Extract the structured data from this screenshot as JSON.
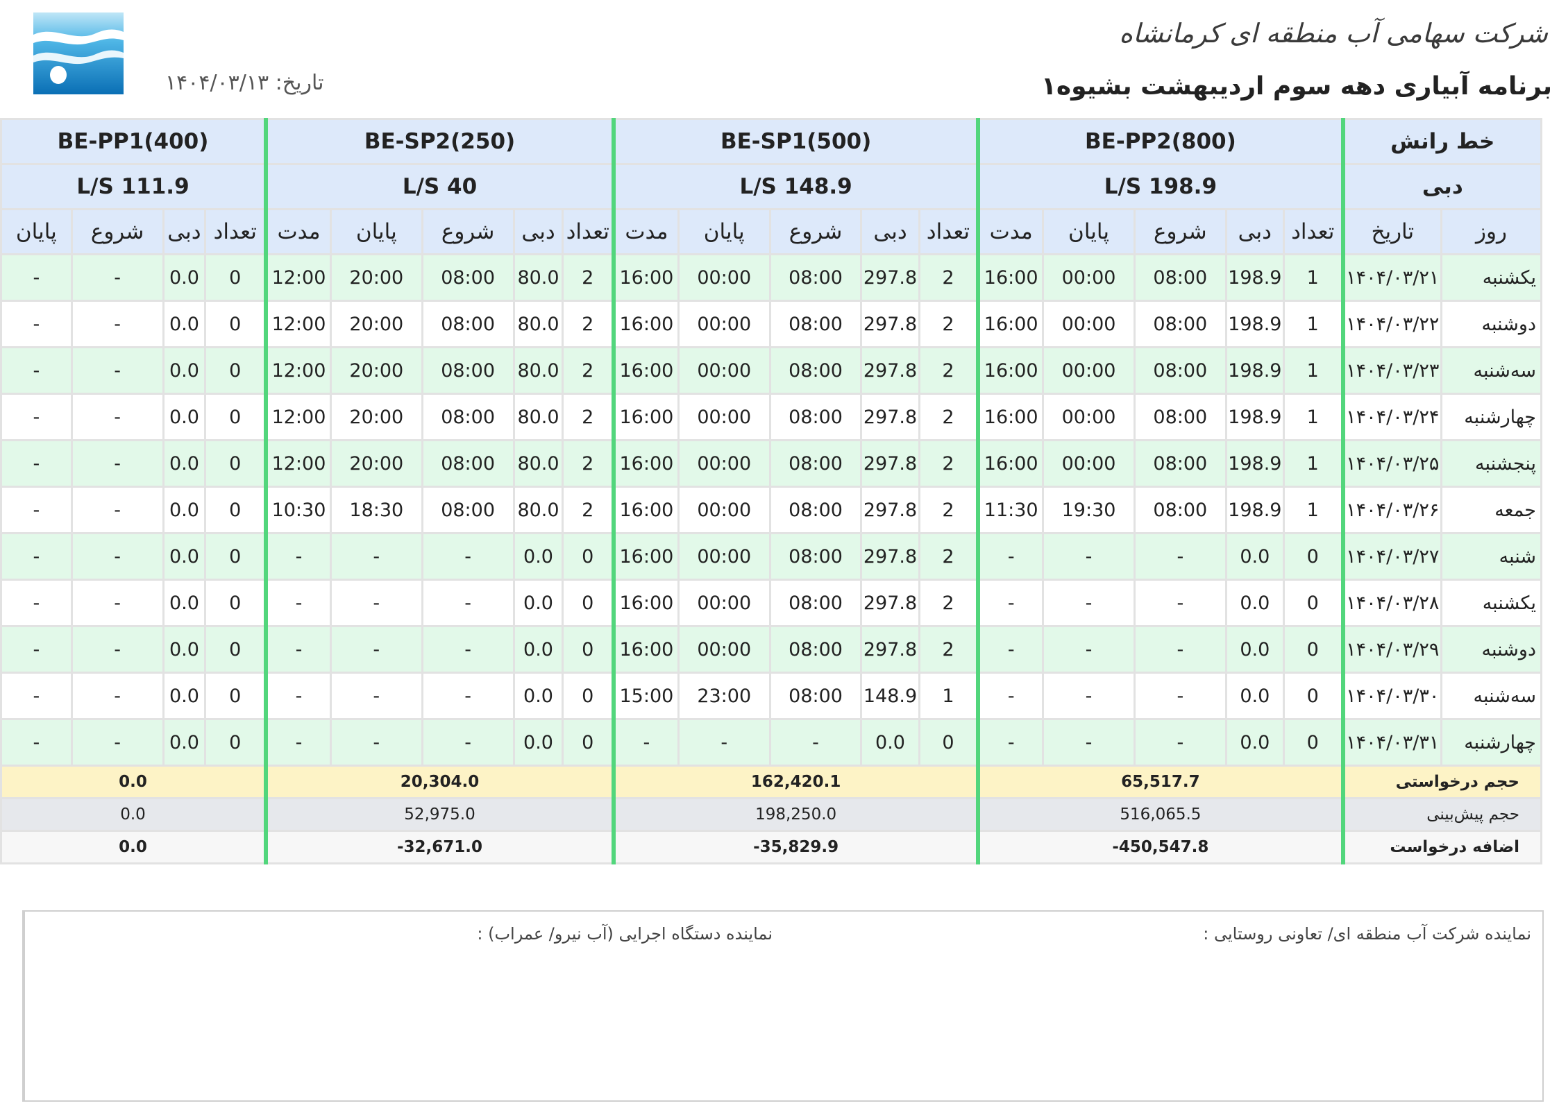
{
  "header": {
    "company": "شرکت سهامی آب منطقه ای کرمانشاه",
    "title": "برنامه آبیاری دهه سوم اردیبهشت بشیوه۱",
    "date_label": "تاریخ:",
    "date_value": "۱۴۰۴/۰۳/۱۳"
  },
  "columns": {
    "line_label": "خط رانش",
    "flow_label": "دبی",
    "day": "روز",
    "date": "تاریخ",
    "count": "تعداد",
    "flow": "دبی",
    "start": "شروع",
    "end": "پایان",
    "duration": "مدت"
  },
  "lines": [
    {
      "name": "BE-PP2(800)",
      "flow": "198.9 L/S"
    },
    {
      "name": "BE-SP1(500)",
      "flow": "148.9 L/S"
    },
    {
      "name": "BE-SP2(250)",
      "flow": "40 L/S"
    },
    {
      "name": "BE-PP1(400)",
      "flow": "111.9 L/S"
    }
  ],
  "rows": [
    {
      "day": "یکشنبه",
      "date": "۱۴۰۴/۰۳/۲۱",
      "l": [
        [
          "1",
          "198.9",
          "08:00",
          "00:00",
          "16:00"
        ],
        [
          "2",
          "297.8",
          "08:00",
          "00:00",
          "16:00"
        ],
        [
          "2",
          "80.0",
          "08:00",
          "20:00",
          "12:00"
        ],
        [
          "0",
          "0.0",
          "-",
          "-"
        ]
      ]
    },
    {
      "day": "دوشنبه",
      "date": "۱۴۰۴/۰۳/۲۲",
      "l": [
        [
          "1",
          "198.9",
          "08:00",
          "00:00",
          "16:00"
        ],
        [
          "2",
          "297.8",
          "08:00",
          "00:00",
          "16:00"
        ],
        [
          "2",
          "80.0",
          "08:00",
          "20:00",
          "12:00"
        ],
        [
          "0",
          "0.0",
          "-",
          "-"
        ]
      ]
    },
    {
      "day": "سه‌شنبه",
      "date": "۱۴۰۴/۰۳/۲۳",
      "l": [
        [
          "1",
          "198.9",
          "08:00",
          "00:00",
          "16:00"
        ],
        [
          "2",
          "297.8",
          "08:00",
          "00:00",
          "16:00"
        ],
        [
          "2",
          "80.0",
          "08:00",
          "20:00",
          "12:00"
        ],
        [
          "0",
          "0.0",
          "-",
          "-"
        ]
      ]
    },
    {
      "day": "چهارشنبه",
      "date": "۱۴۰۴/۰۳/۲۴",
      "l": [
        [
          "1",
          "198.9",
          "08:00",
          "00:00",
          "16:00"
        ],
        [
          "2",
          "297.8",
          "08:00",
          "00:00",
          "16:00"
        ],
        [
          "2",
          "80.0",
          "08:00",
          "20:00",
          "12:00"
        ],
        [
          "0",
          "0.0",
          "-",
          "-"
        ]
      ]
    },
    {
      "day": "پنجشنبه",
      "date": "۱۴۰۴/۰۳/۲۵",
      "l": [
        [
          "1",
          "198.9",
          "08:00",
          "00:00",
          "16:00"
        ],
        [
          "2",
          "297.8",
          "08:00",
          "00:00",
          "16:00"
        ],
        [
          "2",
          "80.0",
          "08:00",
          "20:00",
          "12:00"
        ],
        [
          "0",
          "0.0",
          "-",
          "-"
        ]
      ]
    },
    {
      "day": "جمعه",
      "date": "۱۴۰۴/۰۳/۲۶",
      "l": [
        [
          "1",
          "198.9",
          "08:00",
          "19:30",
          "11:30"
        ],
        [
          "2",
          "297.8",
          "08:00",
          "00:00",
          "16:00"
        ],
        [
          "2",
          "80.0",
          "08:00",
          "18:30",
          "10:30"
        ],
        [
          "0",
          "0.0",
          "-",
          "-"
        ]
      ]
    },
    {
      "day": "شنبه",
      "date": "۱۴۰۴/۰۳/۲۷",
      "l": [
        [
          "0",
          "0.0",
          "-",
          "-",
          "-"
        ],
        [
          "2",
          "297.8",
          "08:00",
          "00:00",
          "16:00"
        ],
        [
          "0",
          "0.0",
          "-",
          "-",
          "-"
        ],
        [
          "0",
          "0.0",
          "-",
          "-"
        ]
      ]
    },
    {
      "day": "یکشنبه",
      "date": "۱۴۰۴/۰۳/۲۸",
      "l": [
        [
          "0",
          "0.0",
          "-",
          "-",
          "-"
        ],
        [
          "2",
          "297.8",
          "08:00",
          "00:00",
          "16:00"
        ],
        [
          "0",
          "0.0",
          "-",
          "-",
          "-"
        ],
        [
          "0",
          "0.0",
          "-",
          "-"
        ]
      ]
    },
    {
      "day": "دوشنبه",
      "date": "۱۴۰۴/۰۳/۲۹",
      "l": [
        [
          "0",
          "0.0",
          "-",
          "-",
          "-"
        ],
        [
          "2",
          "297.8",
          "08:00",
          "00:00",
          "16:00"
        ],
        [
          "0",
          "0.0",
          "-",
          "-",
          "-"
        ],
        [
          "0",
          "0.0",
          "-",
          "-"
        ]
      ]
    },
    {
      "day": "سه‌شنبه",
      "date": "۱۴۰۴/۰۳/۳۰",
      "l": [
        [
          "0",
          "0.0",
          "-",
          "-",
          "-"
        ],
        [
          "1",
          "148.9",
          "08:00",
          "23:00",
          "15:00"
        ],
        [
          "0",
          "0.0",
          "-",
          "-",
          "-"
        ],
        [
          "0",
          "0.0",
          "-",
          "-"
        ]
      ]
    },
    {
      "day": "چهارشنبه",
      "date": "۱۴۰۴/۰۳/۳۱",
      "l": [
        [
          "0",
          "0.0",
          "-",
          "-",
          "-"
        ],
        [
          "0",
          "0.0",
          "-",
          "-",
          "-"
        ],
        [
          "0",
          "0.0",
          "-",
          "-",
          "-"
        ],
        [
          "0",
          "0.0",
          "-",
          "-"
        ]
      ]
    }
  ],
  "footer": [
    {
      "label": "حجم درخواستی",
      "values": [
        "65,517.7",
        "162,420.1",
        "20,304.0",
        "0.0"
      ]
    },
    {
      "label": "حجم پیش‌بینی",
      "values": [
        "516,065.5",
        "198,250.0",
        "52,975.0",
        "0.0"
      ]
    },
    {
      "label": "اضافه درخواست",
      "values": [
        "-450,547.8",
        "-35,829.9",
        "-32,671.0",
        "0.0"
      ]
    }
  ],
  "signatures": {
    "regional": "نماینده شرکت آب منطقه ای/ تعاونی روستایی :",
    "executive": "نماینده دستگاه اجرایی (آب نیرو/ عمراب) :"
  },
  "colors": {
    "header_bg": "#dde9fa",
    "row_green": "#e2f9e9",
    "group_divider": "#52d67c",
    "total_requested_bg": "#fdf3c6",
    "forecast_bg": "#e6e8ec",
    "outer_border": "#f2b47a",
    "logo_blue": "#0a6fb5"
  },
  "icons": {
    "logo": "water-authority-logo-icon"
  }
}
